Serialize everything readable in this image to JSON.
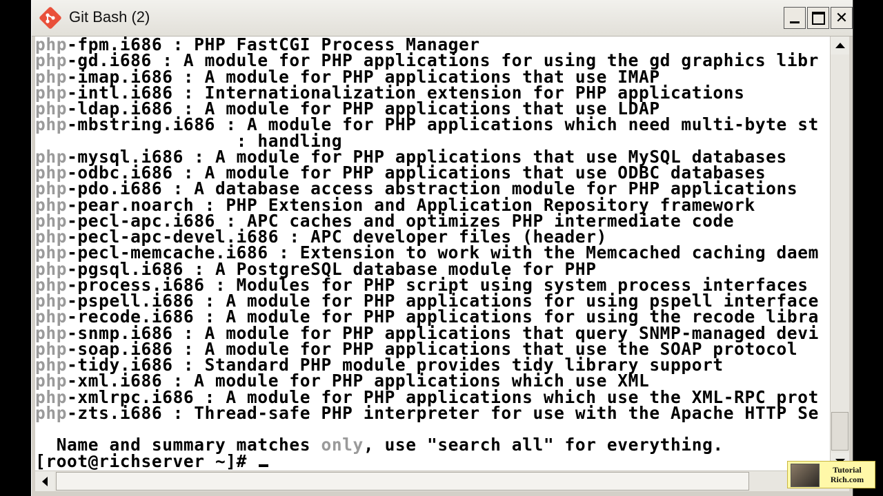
{
  "window": {
    "title": "Git Bash (2)",
    "controls": {
      "minimize": "minimize",
      "maximize": "maximize",
      "close": "✕"
    }
  },
  "terminal": {
    "lines": [
      {
        "prefix": "php",
        "rest": "-fpm.i686 : PHP FastCGI Process Manager"
      },
      {
        "prefix": "php",
        "rest": "-gd.i686 : A module for PHP applications for using the gd graphics libr"
      },
      {
        "prefix": "php",
        "rest": "-imap.i686 : A module for PHP applications that use IMAP"
      },
      {
        "prefix": "php",
        "rest": "-intl.i686 : Internationalization extension for PHP applications"
      },
      {
        "prefix": "php",
        "rest": "-ldap.i686 : A module for PHP applications that use LDAP"
      },
      {
        "prefix": "php",
        "rest": "-mbstring.i686 : A module for PHP applications which need multi-byte st"
      },
      {
        "prefix": "",
        "rest": "                   : handling"
      },
      {
        "prefix": "php",
        "rest": "-mysql.i686 : A module for PHP applications that use MySQL databases"
      },
      {
        "prefix": "php",
        "rest": "-odbc.i686 : A module for PHP applications that use ODBC databases"
      },
      {
        "prefix": "php",
        "rest": "-pdo.i686 : A database access abstraction module for PHP applications"
      },
      {
        "prefix": "php",
        "rest": "-pear.noarch : PHP Extension and Application Repository framework"
      },
      {
        "prefix": "php",
        "rest": "-pecl-apc.i686 : APC caches and optimizes PHP intermediate code"
      },
      {
        "prefix": "php",
        "rest": "-pecl-apc-devel.i686 : APC developer files (header)"
      },
      {
        "prefix": "php",
        "rest": "-pecl-memcache.i686 : Extension to work with the Memcached caching daem"
      },
      {
        "prefix": "php",
        "rest": "-pgsql.i686 : A PostgreSQL database module for PHP"
      },
      {
        "prefix": "php",
        "rest": "-process.i686 : Modules for PHP script using system process interfaces"
      },
      {
        "prefix": "php",
        "rest": "-pspell.i686 : A module for PHP applications for using pspell interface"
      },
      {
        "prefix": "php",
        "rest": "-recode.i686 : A module for PHP applications for using the recode libra"
      },
      {
        "prefix": "php",
        "rest": "-snmp.i686 : A module for PHP applications that query SNMP-managed devi"
      },
      {
        "prefix": "php",
        "rest": "-soap.i686 : A module for PHP applications that use the SOAP protocol"
      },
      {
        "prefix": "php",
        "rest": "-tidy.i686 : Standard PHP module provides tidy library support"
      },
      {
        "prefix": "php",
        "rest": "-xml.i686 : A module for PHP applications which use XML"
      },
      {
        "prefix": "php",
        "rest": "-xmlrpc.i686 : A module for PHP applications which use the XML-RPC prot"
      },
      {
        "prefix": "php",
        "rest": "-zts.i686 : Thread-safe PHP interpreter for use with the Apache HTTP Se"
      },
      {
        "prefix": "",
        "rest": ""
      }
    ],
    "summary": {
      "before": "  Name and summary matches ",
      "highlight": "only",
      "after": ", use \"search all\" for everything."
    },
    "prompt": "[root@richserver ~]# "
  },
  "watermark": {
    "line1": "Tutorial",
    "line2": "Rich.com"
  },
  "colors": {
    "git_logo": "#e9503a",
    "terminal_bg": "#ffffff",
    "terminal_fg": "#000000",
    "dim_text": "#9a9a9a",
    "chrome": "#d4d0c8",
    "watermark_bg": "#fff8a8"
  },
  "icons": {
    "app": "git-logo-icon",
    "scroll_up": "arrow-up-icon",
    "scroll_down": "arrow-down-icon",
    "scroll_left": "arrow-left-icon"
  }
}
